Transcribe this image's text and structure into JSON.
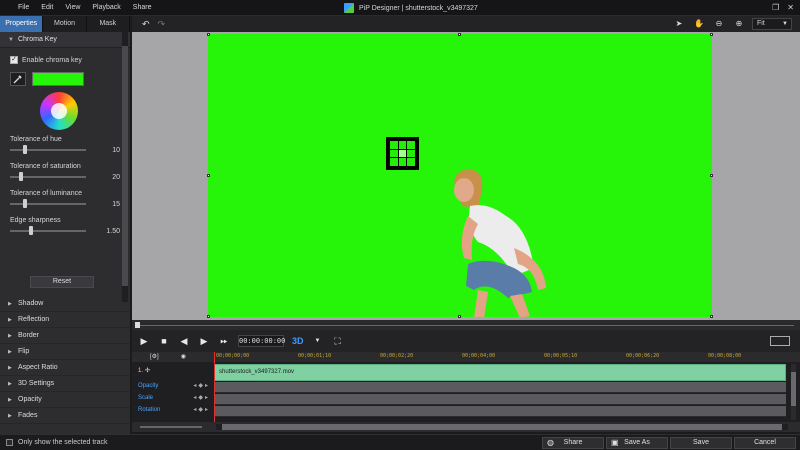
{
  "menu": [
    "File",
    "Edit",
    "View",
    "Playback",
    "Share"
  ],
  "app_title": "PiP Designer | shutterstock_v3497327",
  "tabs": [
    "Properties",
    "Motion",
    "Mask"
  ],
  "chroma_key": {
    "header": "Chroma Key",
    "enable_label": "Enable chroma key",
    "enabled": true,
    "key_color": "#26f50a",
    "sliders": [
      {
        "label": "Tolerance of hue",
        "value": "10",
        "fraction": 0.18
      },
      {
        "label": "Tolerance of saturation",
        "value": "20",
        "fraction": 0.12
      },
      {
        "label": "Tolerance of luminance",
        "value": "15",
        "fraction": 0.18
      },
      {
        "label": "Edge sharpness",
        "value": "1.50",
        "fraction": 0.26
      }
    ],
    "reset_label": "Reset"
  },
  "sections": [
    "Shadow",
    "Reflection",
    "Border",
    "Flip",
    "Aspect Ratio",
    "3D Settings",
    "Opacity",
    "Fades"
  ],
  "preview": {
    "zoom": "Fit",
    "background_color": "#26f50a"
  },
  "playback": {
    "timecode": "00:00:00:00",
    "mode_3d": "3D"
  },
  "timeline": {
    "ticks": [
      "00;00;00;00",
      "00;00;01;10",
      "00;00;02;20",
      "00;00;04;00",
      "00;00;05;10",
      "00;00;06;20",
      "00;00;08;00"
    ],
    "track_number": "1.",
    "clip_name": "shutterstock_v3497327.mov",
    "rows": [
      "Opacity",
      "Scale",
      "Rotation"
    ]
  },
  "bottom": {
    "only_selected": "Only show the selected track",
    "share": "Share",
    "save_as": "Save As",
    "save": "Save",
    "cancel": "Cancel"
  }
}
